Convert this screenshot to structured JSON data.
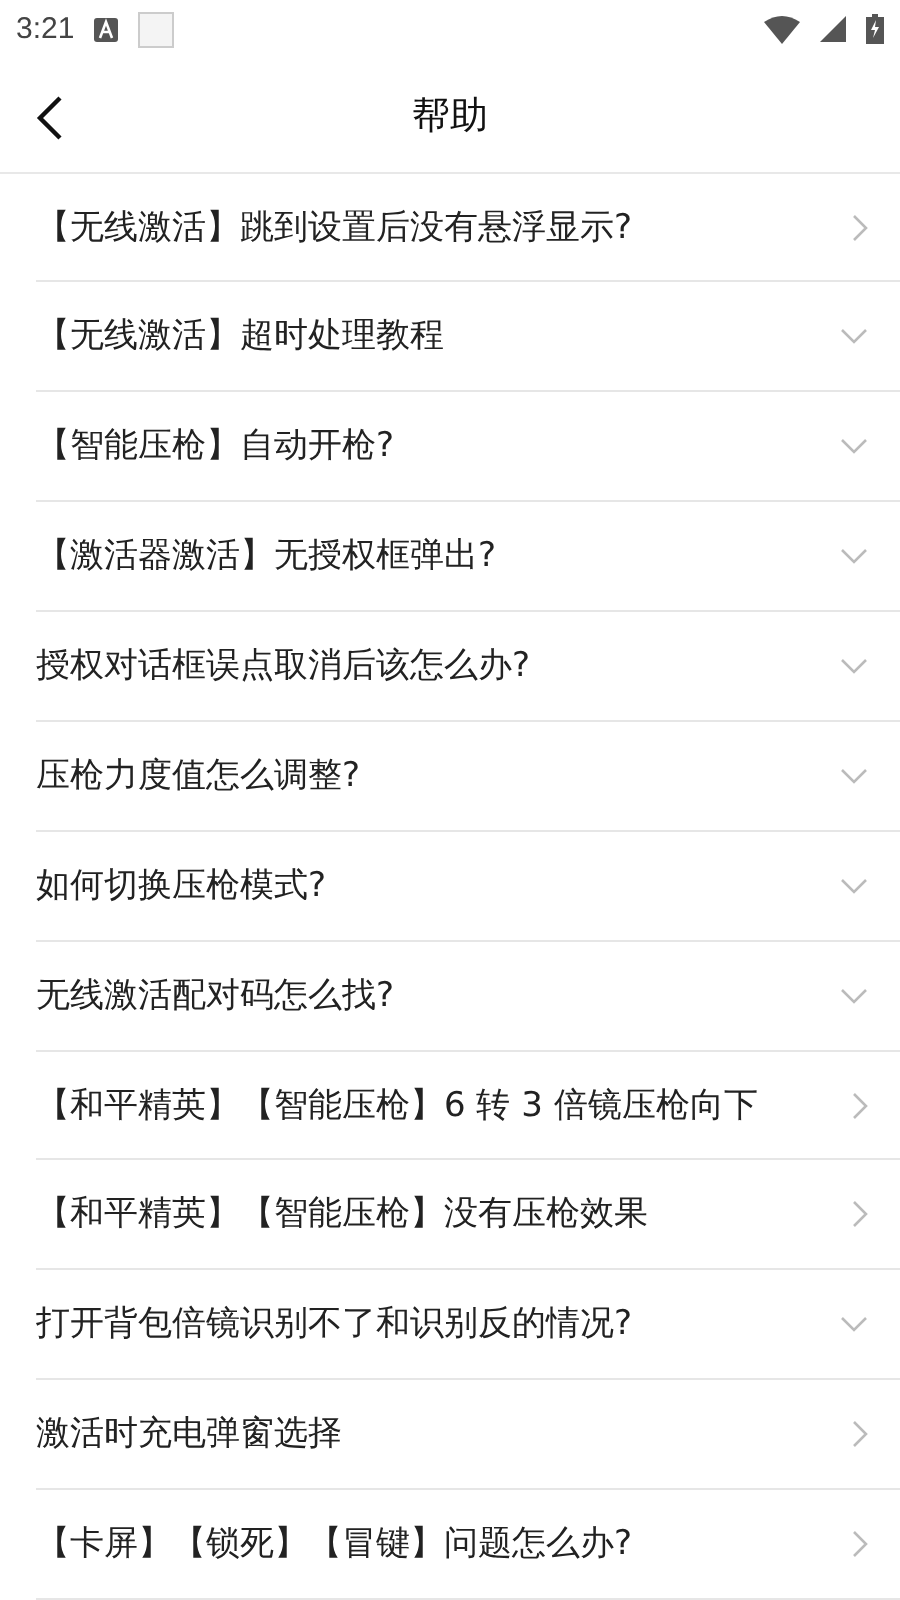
{
  "status_bar": {
    "time": "3:21"
  },
  "header": {
    "title": "帮助"
  },
  "items": [
    {
      "text": "【无线激活】跳到设置后没有悬浮显示?",
      "kind": "link"
    },
    {
      "text": "【无线激活】超时处理教程",
      "kind": "expandable"
    },
    {
      "text": "【智能压枪】自动开枪?",
      "kind": "expandable"
    },
    {
      "text": "【激活器激活】无授权框弹出?",
      "kind": "expandable"
    },
    {
      "text": "授权对话框误点取消后该怎么办?",
      "kind": "expandable"
    },
    {
      "text": "压枪力度值怎么调整?",
      "kind": "expandable"
    },
    {
      "text": "如何切换压枪模式?",
      "kind": "expandable"
    },
    {
      "text": "无线激活配对码怎么找?",
      "kind": "expandable"
    },
    {
      "text": "【和平精英】【智能压枪】6 转 3 倍镜压枪向下",
      "kind": "link"
    },
    {
      "text": "【和平精英】【智能压枪】没有压枪效果",
      "kind": "link"
    },
    {
      "text": "打开背包倍镜识别不了和识别反的情况?",
      "kind": "expandable"
    },
    {
      "text": "激活时充电弹窗选择",
      "kind": "link"
    },
    {
      "text": "【卡屏】【锁死】【冒键】问题怎么办?",
      "kind": "link"
    }
  ]
}
